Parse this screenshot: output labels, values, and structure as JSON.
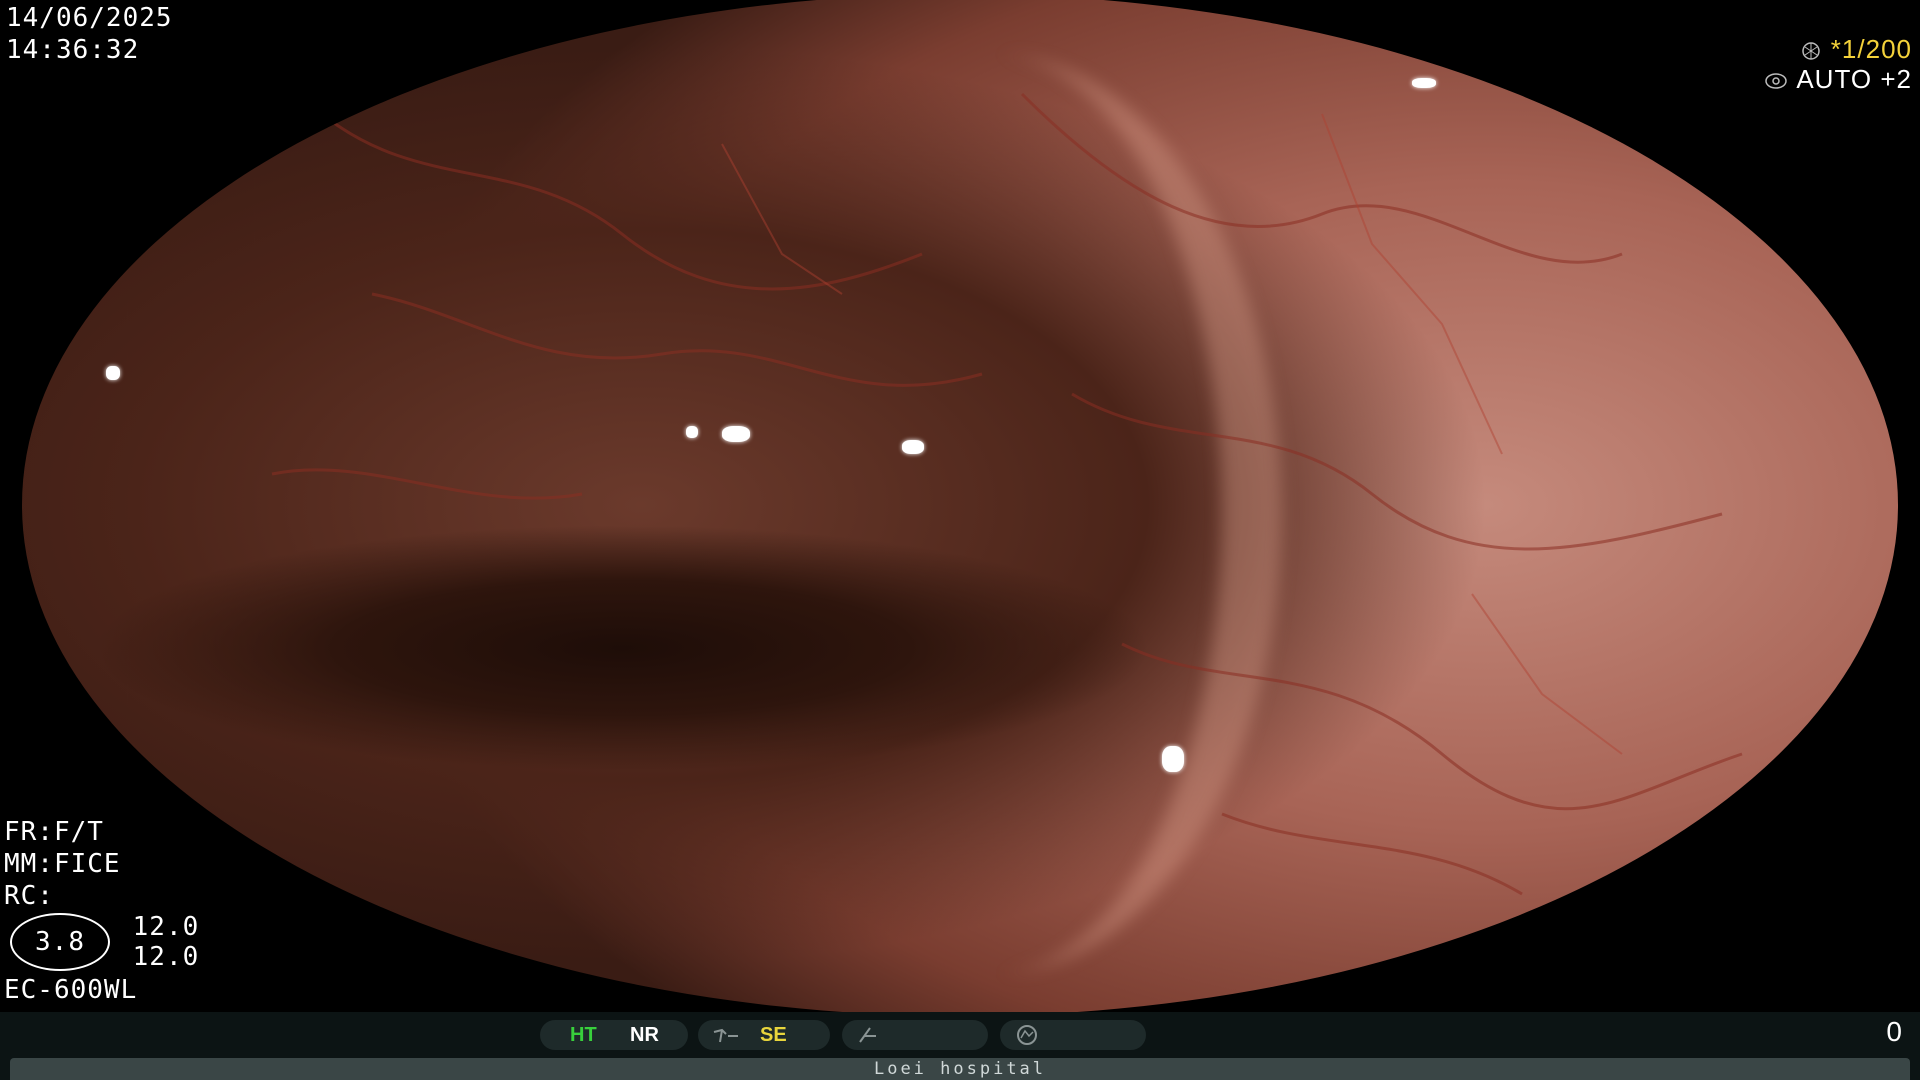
{
  "header": {
    "date": "14/06/2025",
    "time": "14:36:32"
  },
  "exposure": {
    "shutter_icon": "aperture-icon",
    "shutter_value": "1/200",
    "shutter_marker": "*",
    "iris_icon": "iris-icon",
    "iris_mode": "AUTO",
    "iris_offset": "+2"
  },
  "settings": {
    "fr": "FR:F/T",
    "mm": "MM:FICE",
    "rc": "RC:",
    "gauge_value": "3.8",
    "value_1": "12.0",
    "value_2": "12.0",
    "scope_model": "EC-600WL"
  },
  "status_bar": {
    "ht": "HT",
    "nr": "NR",
    "se": "SE",
    "se_icon": "structure-enhance-icon",
    "color_icon": "color-enhance-icon",
    "mode_icon": "mode-circle-icon",
    "counter": "0",
    "colors": {
      "ht": "#38d03c",
      "se": "#e8d53c"
    }
  },
  "footer": {
    "hospital": "Loei hospital"
  }
}
